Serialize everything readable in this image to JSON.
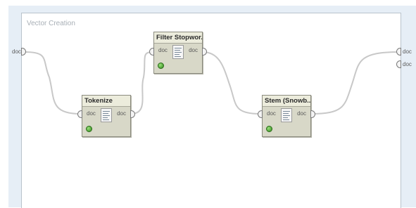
{
  "process": {
    "title": "Vector Creation",
    "input_port": "doc",
    "output_ports": [
      "doc",
      "doc"
    ]
  },
  "operators": [
    {
      "id": "tokenize",
      "title": "Tokenize",
      "input": "doc",
      "output": "doc",
      "status": "ready"
    },
    {
      "id": "filter-stopwords",
      "title": "Filter Stopwor...",
      "input": "doc",
      "output": "doc",
      "status": "ready"
    },
    {
      "id": "stem-snowball",
      "title": "Stem (Snowb...",
      "input": "doc",
      "output": "doc",
      "status": "ready"
    }
  ],
  "colors": {
    "operator_fill": "#d8d8c8",
    "status_ok": "#2f8a1c",
    "wire": "#c8c8c8"
  }
}
